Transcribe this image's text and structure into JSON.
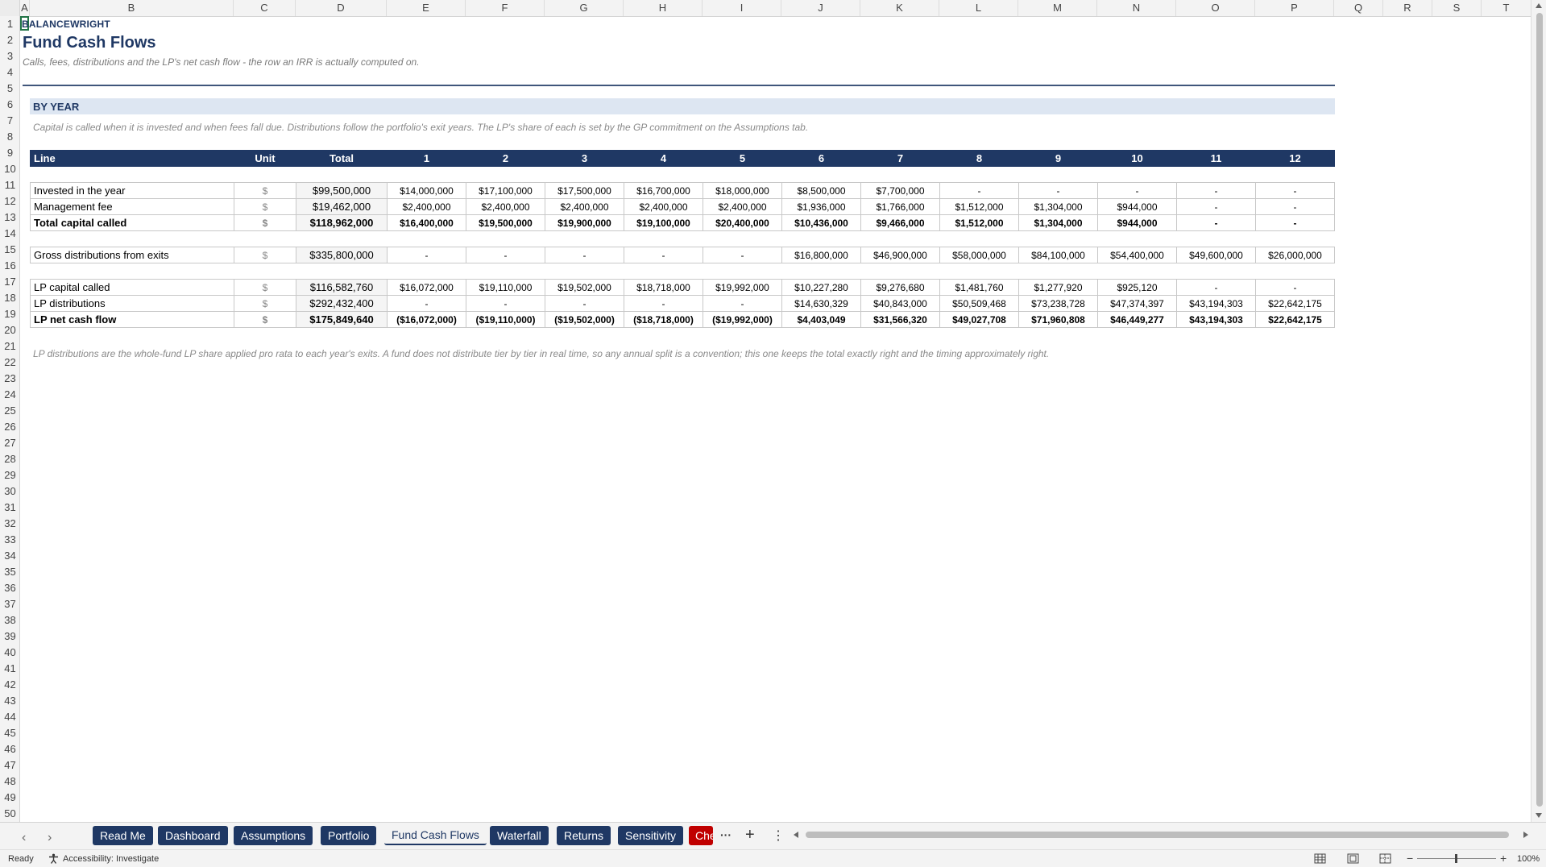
{
  "columns": [
    "A",
    "B",
    "C",
    "D",
    "E",
    "F",
    "G",
    "H",
    "I",
    "J",
    "K",
    "L",
    "M",
    "N",
    "O",
    "P",
    "Q",
    "R",
    "S",
    "T"
  ],
  "rows": [
    "1",
    "2",
    "3",
    "4",
    "5",
    "6",
    "7",
    "8",
    "9",
    "10",
    "11",
    "12",
    "13",
    "14",
    "15",
    "16",
    "17",
    "18",
    "19",
    "20",
    "21",
    "22",
    "23",
    "24",
    "25",
    "26",
    "27",
    "28",
    "29",
    "30",
    "31",
    "32",
    "33",
    "34",
    "35",
    "36",
    "37",
    "38",
    "39",
    "40",
    "41",
    "42",
    "43",
    "44",
    "45",
    "46",
    "47",
    "48",
    "49",
    "50"
  ],
  "sheet": {
    "brand": "BALANCEWRIGHT",
    "title": "Fund Cash Flows",
    "subtitle": "Calls, fees, distributions and the LP's net cash flow - the row an IRR is actually computed on.",
    "section": "BY YEAR",
    "section_note": "Capital is called when it is invested and when fees fall due. Distributions follow the portfolio's exit years. The LP's share of each is set by the GP commitment on the Assumptions tab.",
    "footnote": "LP distributions are the whole-fund LP share applied pro rata to each year's exits. A fund does not distribute tier by tier in real time, so any annual split is a convention; this one keeps the total exactly right and the timing approximately right."
  },
  "table": {
    "header": [
      "Line",
      "Unit",
      "Total",
      "1",
      "2",
      "3",
      "4",
      "5",
      "6",
      "7",
      "8",
      "9",
      "10",
      "11",
      "12"
    ],
    "block1": [
      {
        "cells": [
          "Invested in the year",
          "$",
          "$99,500,000",
          "$14,000,000",
          "$17,100,000",
          "$17,500,000",
          "$16,700,000",
          "$18,000,000",
          "$8,500,000",
          "$7,700,000",
          "-",
          "-",
          "-",
          "-",
          "-"
        ],
        "bold": false
      },
      {
        "cells": [
          "Management fee",
          "$",
          "$19,462,000",
          "$2,400,000",
          "$2,400,000",
          "$2,400,000",
          "$2,400,000",
          "$2,400,000",
          "$1,936,000",
          "$1,766,000",
          "$1,512,000",
          "$1,304,000",
          "$944,000",
          "-",
          "-"
        ],
        "bold": false
      },
      {
        "cells": [
          "Total capital called",
          "$",
          "$118,962,000",
          "$16,400,000",
          "$19,500,000",
          "$19,900,000",
          "$19,100,000",
          "$20,400,000",
          "$10,436,000",
          "$9,466,000",
          "$1,512,000",
          "$1,304,000",
          "$944,000",
          "-",
          "-"
        ],
        "bold": true
      }
    ],
    "block2": [
      {
        "cells": [
          "Gross distributions from exits",
          "$",
          "$335,800,000",
          "-",
          "-",
          "-",
          "-",
          "-",
          "$16,800,000",
          "$46,900,000",
          "$58,000,000",
          "$84,100,000",
          "$54,400,000",
          "$49,600,000",
          "$26,000,000"
        ],
        "bold": false
      }
    ],
    "block3": [
      {
        "cells": [
          "LP capital called",
          "$",
          "$116,582,760",
          "$16,072,000",
          "$19,110,000",
          "$19,502,000",
          "$18,718,000",
          "$19,992,000",
          "$10,227,280",
          "$9,276,680",
          "$1,481,760",
          "$1,277,920",
          "$925,120",
          "-",
          "-"
        ],
        "bold": false
      },
      {
        "cells": [
          "LP distributions",
          "$",
          "$292,432,400",
          "-",
          "-",
          "-",
          "-",
          "-",
          "$14,630,329",
          "$40,843,000",
          "$50,509,468",
          "$73,238,728",
          "$47,374,397",
          "$43,194,303",
          "$22,642,175"
        ],
        "bold": false
      },
      {
        "cells": [
          "LP net cash flow",
          "$",
          "$175,849,640",
          "($16,072,000)",
          "($19,110,000)",
          "($19,502,000)",
          "($18,718,000)",
          "($19,992,000)",
          "$4,403,049",
          "$31,566,320",
          "$49,027,708",
          "$71,960,808",
          "$46,449,277",
          "$43,194,303",
          "$22,642,175"
        ],
        "bold": true
      }
    ]
  },
  "tabs": [
    {
      "label": "Read Me",
      "active": false
    },
    {
      "label": "Dashboard",
      "active": false
    },
    {
      "label": "Assumptions",
      "active": false
    },
    {
      "label": "Portfolio",
      "active": false
    },
    {
      "label": "Fund Cash Flows",
      "active": true
    },
    {
      "label": "Waterfall",
      "active": false
    },
    {
      "label": "Returns",
      "active": false
    },
    {
      "label": "Sensitivity",
      "active": false
    },
    {
      "label": "Che",
      "active": false
    }
  ],
  "tabnav": {
    "prev": "‹",
    "next": "›",
    "more": "···",
    "add": "+",
    "menu": "⋮"
  },
  "status": {
    "ready": "Ready",
    "accessibility": "Accessibility: Investigate",
    "zoom": "100%"
  },
  "colors": {
    "navy": "#1f3864",
    "band": "#dde6f2",
    "red_tab": "#c00000",
    "selection": "#217346"
  }
}
